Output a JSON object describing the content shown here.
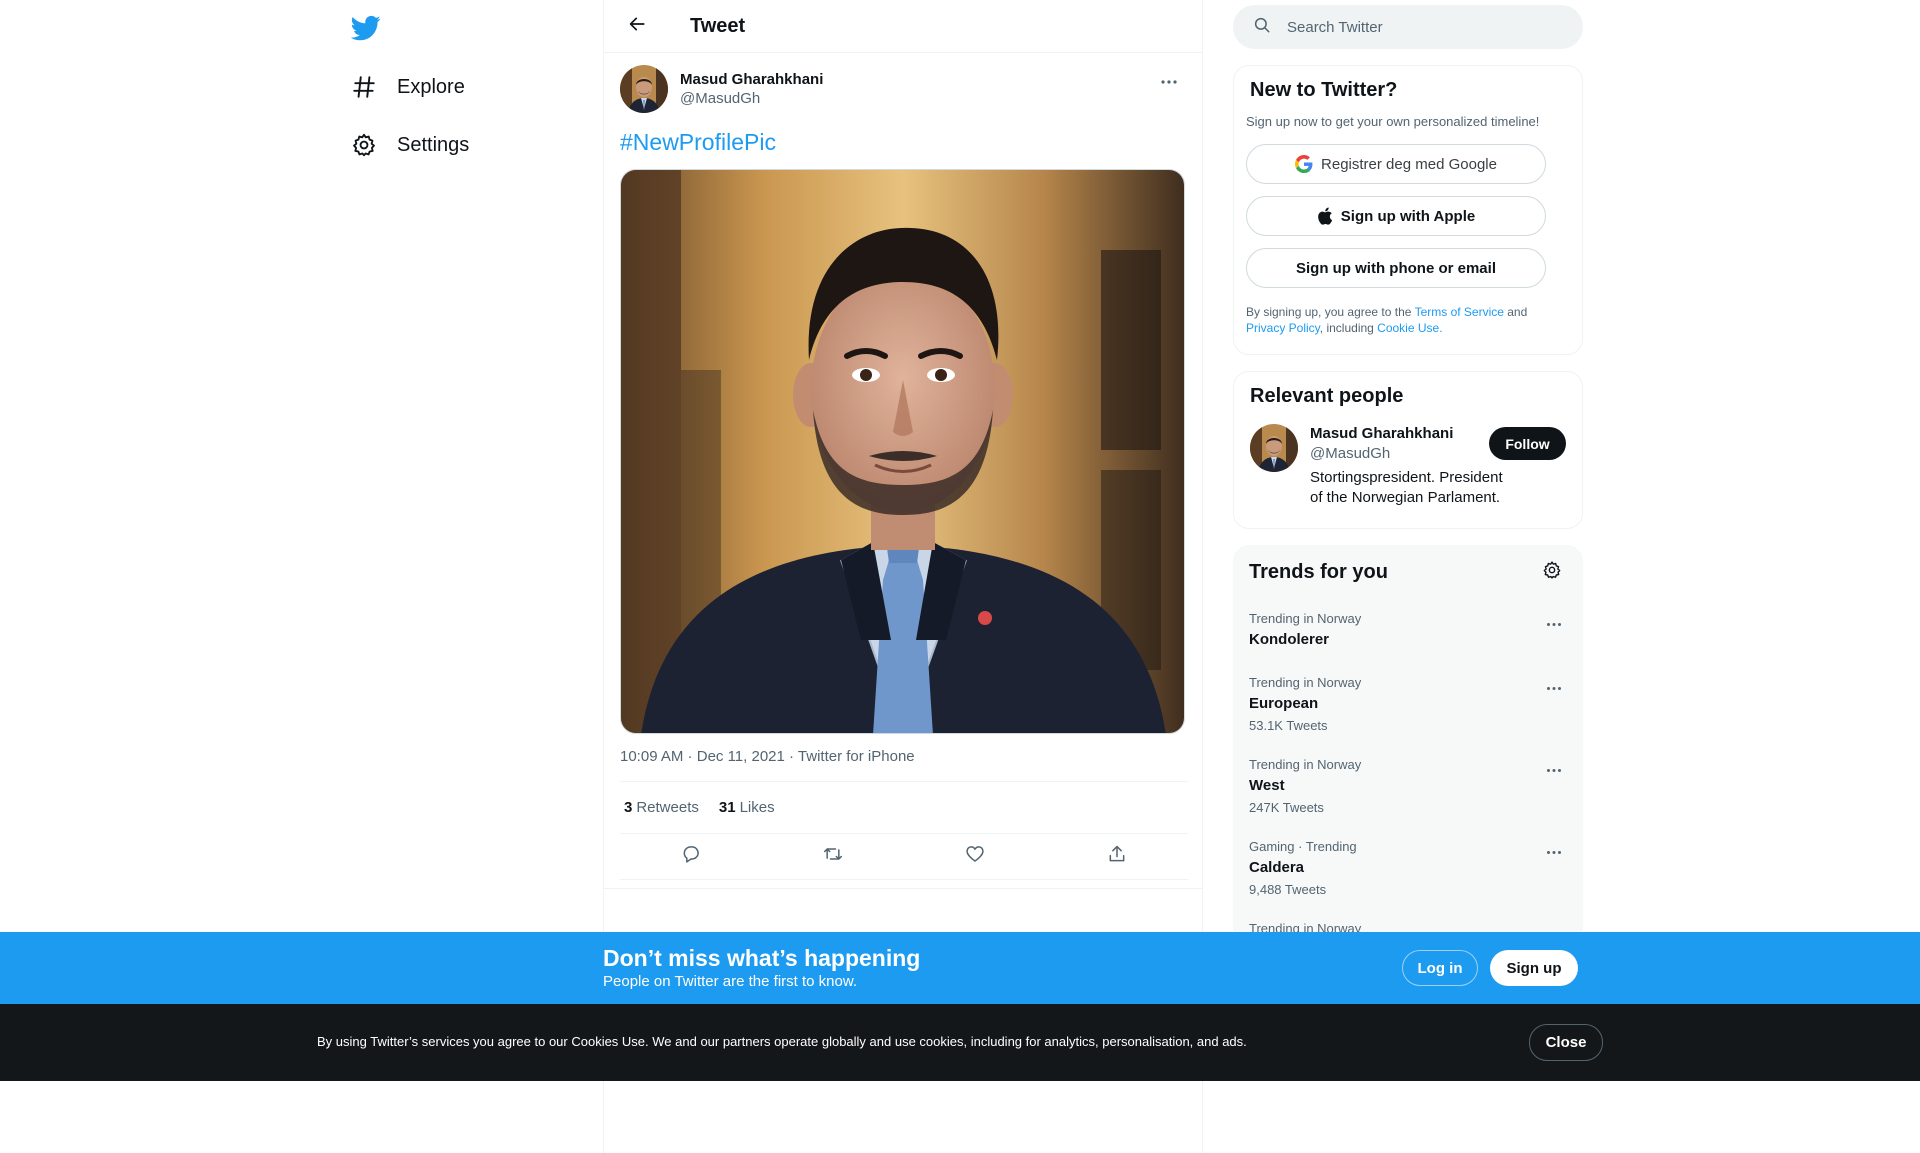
{
  "nav": {
    "logo_icon": "twitter-bird-icon",
    "brand_color": "#1d9bf0",
    "items": [
      {
        "label": "Explore",
        "icon": "hashtag-icon"
      },
      {
        "label": "Settings",
        "icon": "gear-icon"
      }
    ]
  },
  "header": {
    "title": "Tweet",
    "back_icon": "arrow-left-icon"
  },
  "tweet": {
    "author_name": "Masud Gharahkhani",
    "author_handle": "@MasudGh",
    "text": "#NewProfilePic",
    "time": "10:09 AM",
    "date": "Dec 11, 2021",
    "source": "Twitter for iPhone",
    "retweets_count": "3",
    "retweets_label": "Retweets",
    "likes_count": "31",
    "likes_label": "Likes"
  },
  "search": {
    "placeholder": "Search Twitter"
  },
  "signup": {
    "title": "New to Twitter?",
    "subtitle": "Sign up now to get your own personalized timeline!",
    "google_label": "Registrer deg med Google",
    "apple_label": "Sign up with Apple",
    "phone_label": "Sign up with phone or email",
    "legal_prefix": "By signing up, you agree to the ",
    "tos": "Terms of Service",
    "and": " and",
    "privacy": "Privacy Policy",
    "including": ", including ",
    "cookie": "Cookie Use."
  },
  "relevant": {
    "title": "Relevant people",
    "name": "Masud Gharahkhani",
    "handle": "@MasudGh",
    "bio": "Stortingspresident. President of the Norwegian Parlament.",
    "follow_label": "Follow"
  },
  "trends": {
    "title": "Trends for you",
    "items": [
      {
        "context": "Trending in Norway",
        "name": "Kondolerer",
        "count": ""
      },
      {
        "context": "Trending in Norway",
        "name": "European",
        "count": "53.1K Tweets"
      },
      {
        "context": "Trending in Norway",
        "name": "West",
        "count": "247K Tweets"
      },
      {
        "context": "Gaming · Trending",
        "name": "Caldera",
        "count": "9,488 Tweets"
      },
      {
        "context": "Trending in Norway",
        "name": "",
        "count": ""
      }
    ]
  },
  "banner": {
    "title": "Don’t miss what’s happening",
    "subtitle": "People on Twitter are the first to know.",
    "login_label": "Log in",
    "signup_label": "Sign up"
  },
  "cookie": {
    "text": "By using Twitter’s services you agree to our Cookies Use. We and our partners operate globally and use cookies, including for analytics, personalisation, and ads.",
    "close_label": "Close"
  }
}
